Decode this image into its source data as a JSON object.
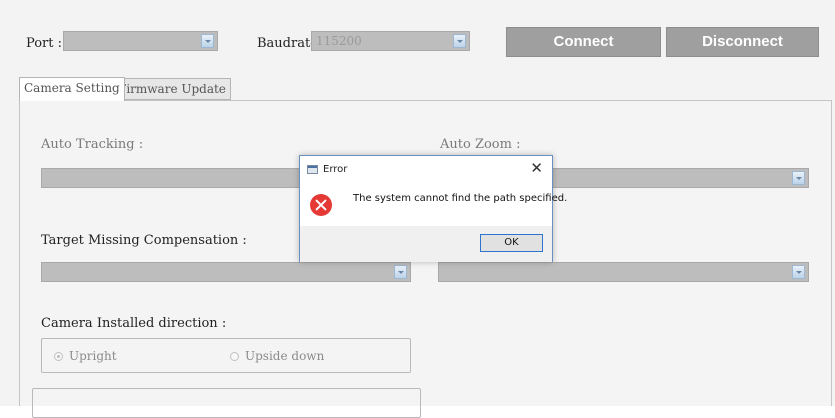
{
  "header": {
    "port_label": "Port :",
    "port_value": "",
    "baudrate_label": "Baudrate:",
    "baudrate_value": "115200",
    "connect_label": "Connect",
    "disconnect_label": "Disconnect"
  },
  "tabs": [
    {
      "label": "Camera Setting",
      "active": true
    },
    {
      "label": "Firmware Update",
      "active": false
    }
  ],
  "settings": {
    "auto_tracking_label": "Auto Tracking :",
    "auto_zoom_label": "Auto Zoom :",
    "target_missing_label": "Target Missing Compensation :",
    "installed_direction_label": "Camera Installed direction :",
    "direction_options": [
      {
        "label": "Upright",
        "selected": true
      },
      {
        "label": "Upside down",
        "selected": false
      }
    ]
  },
  "dialog": {
    "title": "Error",
    "close_glyph": "✕",
    "message": "The system cannot find the path specified.",
    "ok_label": "OK"
  },
  "colors": {
    "button_bg": "#9f9f9f",
    "error_red": "#e53935",
    "dialog_border": "#6a8fc0"
  }
}
